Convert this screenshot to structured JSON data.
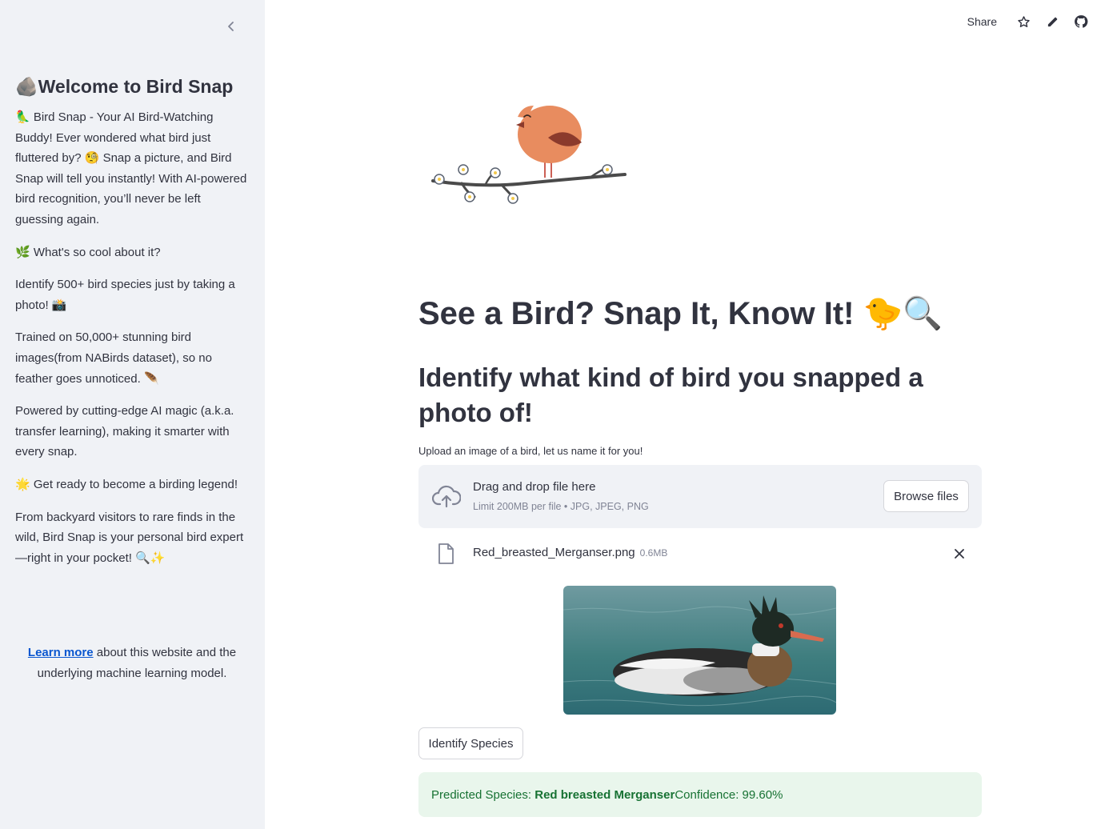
{
  "sidebar": {
    "title": "🪨Welcome to Bird Snap",
    "intro": "🦜 Bird Snap - Your AI Bird-Watching Buddy! Ever wondered what bird just fluttered by? 🧐 Snap a picture, and Bird Snap will tell you instantly! With AI-powered bird recognition, you’ll never be left guessing again.",
    "cool_heading": "🌿 What's so cool about it?",
    "point1": "Identify 500+ bird species just by taking a photo! 📸",
    "point2": "Trained on 50,000+ stunning bird images(from NABirds dataset), so no feather goes unnoticed. 🪶",
    "point3": "Powered by cutting-edge AI magic (a.k.a. transfer learning), making it smarter with every snap.",
    "legend": "🌟 Get ready to become a birding legend!",
    "closing": "From backyard visitors to rare finds in the wild, Bird Snap is your personal bird expert—right in your pocket! 🔍✨",
    "footer_link": "Learn more",
    "footer_text": " about this website and the underlying machine learning model."
  },
  "toolbar": {
    "share_label": "Share"
  },
  "main": {
    "title": "See a Bird? Snap It, Know It! 🐤🔍",
    "subtitle": "Identify what kind of bird you snapped a photo of!",
    "upload_label": "Upload an image of a bird, let us name it for you!",
    "dropzone_title": "Drag and drop file here",
    "dropzone_limit": "Limit 200MB per file • JPG, JPEG, PNG",
    "browse_label": "Browse files",
    "file_name": "Red_breasted_Merganser.png",
    "file_size": "0.6MB",
    "identify_label": "Identify Species",
    "result_prefix": "Predicted Species: ",
    "result_species": "Red breasted Merganser",
    "result_confidence": " Confidence: 99.60%"
  },
  "colors": {
    "sidebar_bg": "#f0f2f6",
    "success_bg": "#e9f6ec",
    "success_text": "#177233",
    "link": "#0b57d0"
  }
}
